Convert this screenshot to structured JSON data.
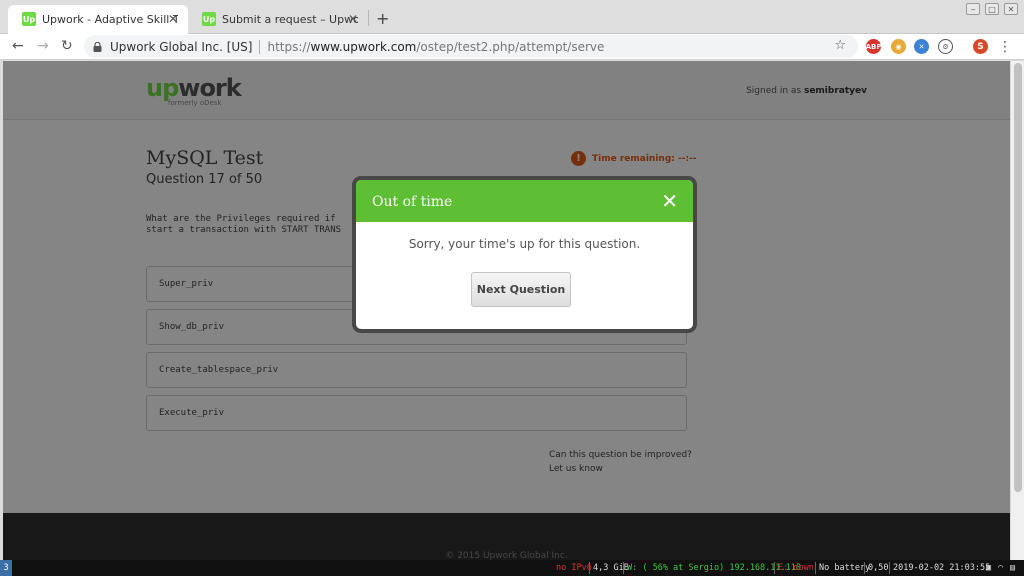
{
  "browser": {
    "tabs": [
      {
        "label": "Upwork - Adaptive Skill Te",
        "favicon": "Up",
        "active": true
      },
      {
        "label": "Submit a request – Upwork",
        "favicon": "Up",
        "active": false
      }
    ],
    "url_org": "Upwork Global Inc. [US]",
    "url_scheme": "https://",
    "url_host": "www.upwork.com",
    "url_path": "/ostep/test2.php/attempt/serve",
    "extensions": [
      "ABP",
      "cookie-icon",
      "sync-icon",
      "puzzle-icon"
    ],
    "profile_initial": "S"
  },
  "header": {
    "logo_up": "up",
    "logo_work": "work",
    "logo_sub": "formerly oDesk",
    "signed_prefix": "Signed in as",
    "username": "semibratyev"
  },
  "test": {
    "title": "MySQL Test",
    "question_num": "Question 17 of 50",
    "time_label": "Time remaining: --:--",
    "question_text": "What are the Privileges required if\nstart a transaction with START TRANS",
    "answers": [
      "Super_priv",
      "Show_db_priv",
      "Create_tablespace_priv",
      "Execute_priv"
    ],
    "improve_line1": "Can this question be improved?",
    "improve_line2": "Let us know"
  },
  "footer": {
    "copyright": "© 2015 Upwork Global Inc."
  },
  "modal": {
    "title": "Out of time",
    "close": "✕",
    "message": "Sorry, your time's up for this question.",
    "button": "Next Question"
  },
  "taskbar": {
    "workspace": "3",
    "ipv6": "no IPv6",
    "mem": "4,3 GiB",
    "wifi": "W: ( 56% at Sergio) 192.168.11.110",
    "eth": "E: down",
    "battery": "No battery",
    "load": "0,50",
    "datetime": "2019-02-02 21:03:55"
  },
  "colors": {
    "brand_green": "#6fda44",
    "modal_header": "#5fbf34",
    "alert_orange": "#e05a1a"
  }
}
